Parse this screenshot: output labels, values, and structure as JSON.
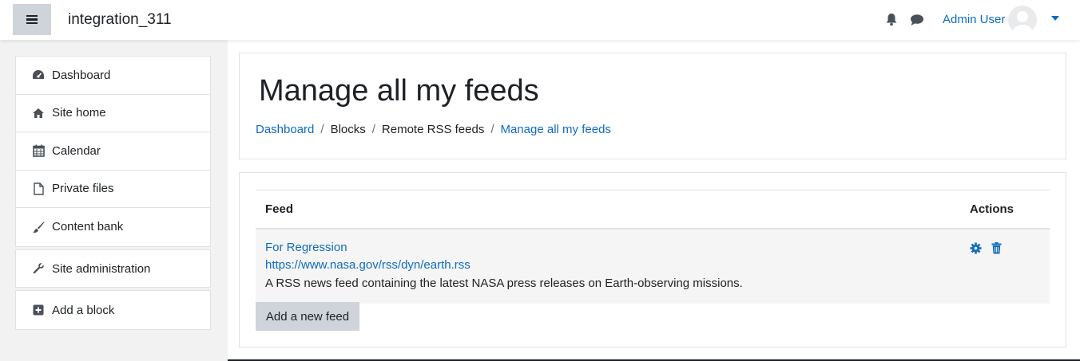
{
  "navbar": {
    "site_name": "integration_311",
    "user_name": "Admin User",
    "icons": [
      "menu-icon",
      "bell-icon",
      "chat-icon",
      "avatar-icon",
      "caret-down-icon"
    ]
  },
  "sidebar": {
    "items": [
      {
        "label": "Dashboard",
        "icon": "dashboard-icon"
      },
      {
        "label": "Site home",
        "icon": "home-icon"
      },
      {
        "label": "Calendar",
        "icon": "calendar-icon"
      },
      {
        "label": "Private files",
        "icon": "file-icon"
      },
      {
        "label": "Content bank",
        "icon": "paintbrush-icon"
      }
    ],
    "admin": {
      "label": "Site administration",
      "icon": "wrench-icon"
    },
    "add_block": {
      "label": "Add a block",
      "icon": "plus-square-icon"
    }
  },
  "header": {
    "title": "Manage all my feeds",
    "breadcrumb": [
      "Dashboard",
      "Blocks",
      "Remote RSS feeds",
      "Manage all my feeds"
    ]
  },
  "table": {
    "headers": {
      "feed": "Feed",
      "actions": "Actions"
    },
    "rows": [
      {
        "title": "For Regression",
        "url": "https://www.nasa.gov/rss/dyn/earth.rss",
        "description": "A RSS news feed containing the latest NASA press releases on Earth-observing missions.",
        "actions": [
          "settings-icon",
          "trash-icon"
        ]
      }
    ]
  },
  "add_button": "Add a new feed",
  "colors": {
    "link": "#0f6cbf",
    "text": "#1d2125",
    "button_bg": "#ced4da",
    "page_bg": "#f2f2f2",
    "row_bg": "#f5f5f5"
  }
}
